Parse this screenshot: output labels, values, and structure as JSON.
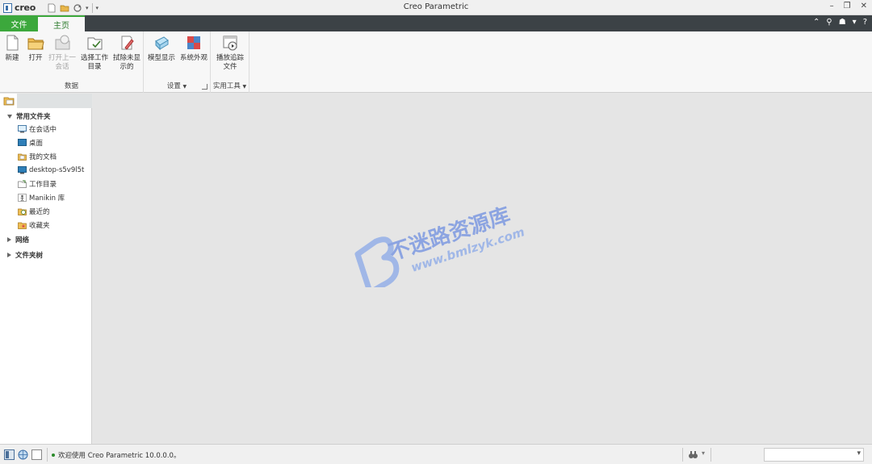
{
  "app": {
    "logo": "creo",
    "title": "Creo Parametric"
  },
  "tabs": {
    "file": "文件",
    "home": "主页"
  },
  "ribbon": {
    "groups": {
      "data": "数据",
      "settings": "设置",
      "utilities": "实用工具"
    },
    "buttons": {
      "new": "新建",
      "open": "打开",
      "open_last_1": "打开上一",
      "open_last_2": "会话",
      "select_wd_1": "选择工作",
      "select_wd_2": "目录",
      "erase_1": "拭除未显",
      "erase_2": "示的",
      "model_display": "模型显示",
      "system_appearance": "系统外观",
      "playback_1": "播放追踪",
      "playback_2": "文件"
    }
  },
  "navigator": {
    "common_folders": "常用文件夹",
    "items": [
      {
        "label": "在会话中",
        "icon": "session-icon"
      },
      {
        "label": "桌面",
        "icon": "desktop-icon"
      },
      {
        "label": "我的文档",
        "icon": "documents-icon"
      },
      {
        "label": "desktop-s5v9l5t",
        "icon": "computer-icon"
      },
      {
        "label": "工作目录",
        "icon": "working-directory-icon"
      },
      {
        "label": "Manikin 库",
        "icon": "manikin-icon"
      },
      {
        "label": "最近的",
        "icon": "recent-icon"
      },
      {
        "label": "收藏夹",
        "icon": "favorites-icon"
      }
    ],
    "network": "网络",
    "folder_tree": "文件夹树"
  },
  "watermark": {
    "brand": "不迷路资源库",
    "url": "www.bmlzyk.com"
  },
  "status": {
    "message": "欢迎使用 Creo Parametric 10.0.0.0。"
  },
  "colors": {
    "accent": "#3ca83c",
    "tabbar": "#3c4246",
    "canvas": "#e5e5e5"
  }
}
